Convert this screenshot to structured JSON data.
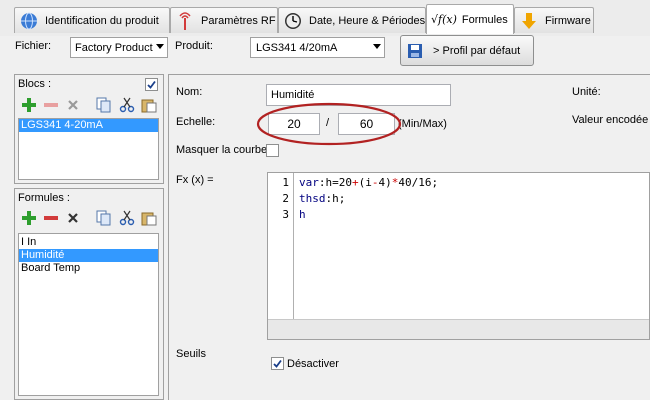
{
  "tabs": [
    {
      "label": "Identification du produit",
      "icon": "globe-icon"
    },
    {
      "label": "Paramètres RF",
      "icon": "antenna-icon"
    },
    {
      "label": "Date, Heure & Périodes",
      "icon": "clock-icon"
    },
    {
      "label": "Formules",
      "icon": "sqrt-fx-icon",
      "prefix": "√f(x)",
      "active": true
    },
    {
      "label": "Firmware",
      "icon": "down-arrow-icon"
    }
  ],
  "toolbar": {
    "fichier_label": "Fichier:",
    "fichier_value": "Factory Product",
    "produit_label": "Produit:",
    "produit_value": "LGS341 4/20mA",
    "profil_button": "> Profil par défaut"
  },
  "blocs": {
    "title": "Blocs :",
    "checked": true,
    "items": [
      {
        "label": "LGS341 4-20mA",
        "selected": true
      }
    ]
  },
  "formules": {
    "title": "Formules :",
    "items": [
      {
        "label": "I In",
        "selected": false
      },
      {
        "label": "Humidité",
        "selected": true
      },
      {
        "label": "Board Temp",
        "selected": false
      }
    ]
  },
  "form": {
    "nom_label": "Nom:",
    "nom_value": "Humidité",
    "unite_label": "Unité:",
    "echelle_label": "Echelle:",
    "echelle_min": "20",
    "echelle_sep": "/",
    "echelle_max": "60",
    "echelle_hint": "(Min/Max)",
    "valeur_label": "Valeur encodée",
    "masquer_label": "Masquer la courbe",
    "masquer_checked": false,
    "fx_label": "Fx (x) =",
    "seuils_label": "Seuils",
    "desactiver_label": "Désactiver",
    "desactiver_checked": true
  },
  "code": {
    "line_numbers": [
      "1",
      "2",
      "3"
    ]
  },
  "colors": {
    "selection": "#3399ff",
    "annotation_circle": "#b22222",
    "add_icon": "#2e9e2e",
    "remove_icon": "#d23b3b"
  }
}
